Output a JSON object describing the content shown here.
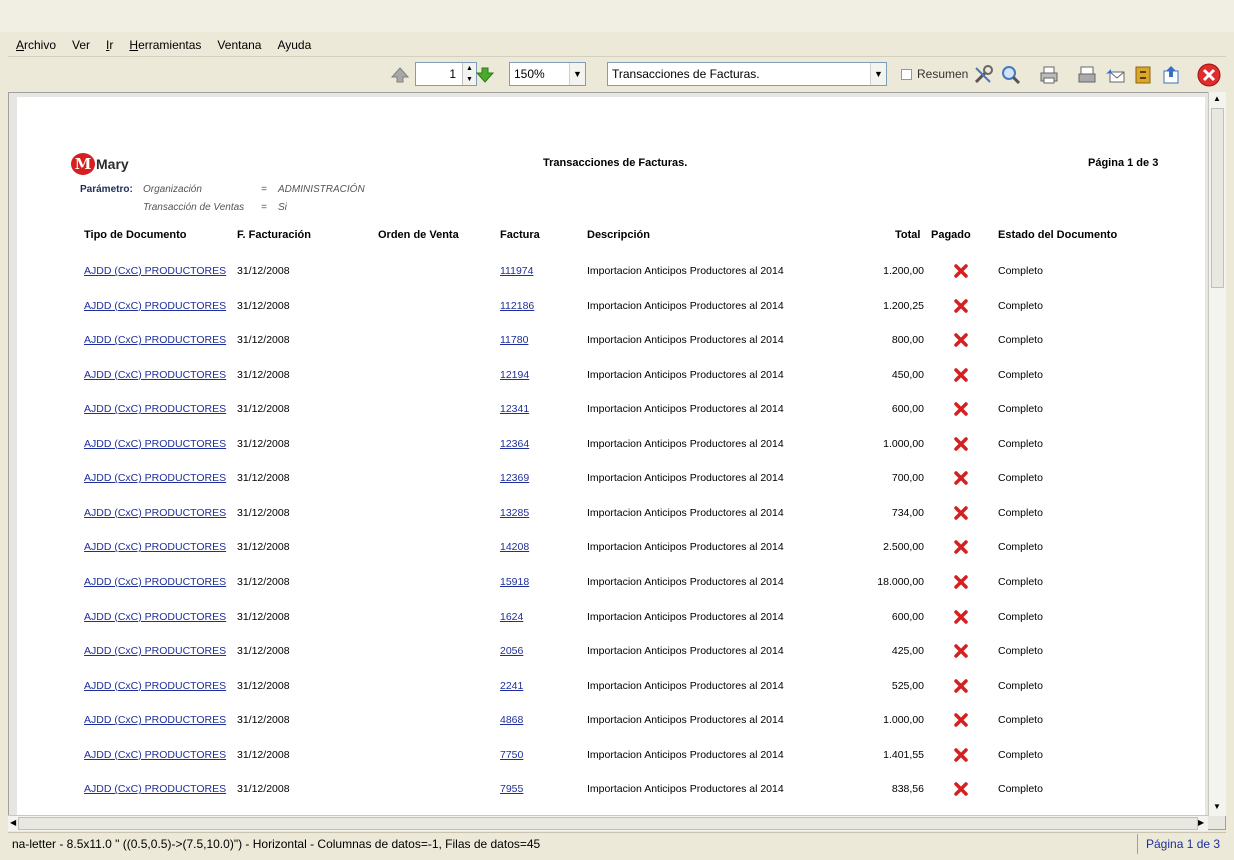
{
  "menu": [
    {
      "label": "Archivo",
      "mnemonic": "A"
    },
    {
      "label": "Ver",
      "mnemonic": ""
    },
    {
      "label": "Ir",
      "mnemonic": "I"
    },
    {
      "label": "Herramientas",
      "mnemonic": "H"
    },
    {
      "label": "Ventana",
      "mnemonic": ""
    },
    {
      "label": "Ayuda",
      "mnemonic": ""
    }
  ],
  "toolbar": {
    "page_value": "1",
    "zoom_value": "150%",
    "report_value": "Transacciones de Facturas.",
    "resumen_label": "Resumen",
    "icons": {
      "prev": "arrow-up-icon",
      "next": "arrow-down-icon",
      "customize": "tools-icon",
      "find": "magnifier-icon",
      "print": "printer-icon",
      "fax": "print-setup-icon",
      "email": "send-mail-icon",
      "archive": "archive-icon",
      "export": "export-icon",
      "close": "close-icon"
    }
  },
  "report": {
    "title": "Transacciones de Facturas.",
    "page_label": "Página 1 de 3",
    "logo_text": "Mary",
    "logo_sub": "",
    "param_label": "Parámetro:",
    "params": [
      {
        "name": "Organización",
        "eq": "=",
        "value": "ADMINISTRACIÓN"
      },
      {
        "name": "Transacción de Ventas",
        "eq": "=",
        "value": "Si"
      }
    ],
    "columns": {
      "tipo": "Tipo de Documento",
      "fecha": "F. Facturación",
      "orden": "Orden de Venta",
      "factura": "Factura",
      "descripcion": "Descripción",
      "total": "Total",
      "pagado": "Pagado",
      "estado": "Estado del Documento"
    },
    "rows": [
      {
        "tipo": "AJDD (CxC) PRODUCTORES",
        "fecha": "31/12/2008",
        "orden": "",
        "factura": "111974",
        "descripcion": "Importacion Anticipos Productores al 2014",
        "total": "1.200,00",
        "estado": "Completo"
      },
      {
        "tipo": "AJDD (CxC) PRODUCTORES",
        "fecha": "31/12/2008",
        "orden": "",
        "factura": "112186",
        "descripcion": "Importacion Anticipos Productores al 2014",
        "total": "1.200,25",
        "estado": "Completo"
      },
      {
        "tipo": "AJDD (CxC) PRODUCTORES",
        "fecha": "31/12/2008",
        "orden": "",
        "factura": "11780",
        "descripcion": "Importacion Anticipos Productores al 2014",
        "total": "800,00",
        "estado": "Completo"
      },
      {
        "tipo": "AJDD (CxC) PRODUCTORES",
        "fecha": "31/12/2008",
        "orden": "",
        "factura": "12194",
        "descripcion": "Importacion Anticipos Productores al 2014",
        "total": "450,00",
        "estado": "Completo"
      },
      {
        "tipo": "AJDD (CxC) PRODUCTORES",
        "fecha": "31/12/2008",
        "orden": "",
        "factura": "12341",
        "descripcion": "Importacion Anticipos Productores al 2014",
        "total": "600,00",
        "estado": "Completo"
      },
      {
        "tipo": "AJDD (CxC) PRODUCTORES",
        "fecha": "31/12/2008",
        "orden": "",
        "factura": "12364",
        "descripcion": "Importacion Anticipos Productores al 2014",
        "total": "1.000,00",
        "estado": "Completo"
      },
      {
        "tipo": "AJDD (CxC) PRODUCTORES",
        "fecha": "31/12/2008",
        "orden": "",
        "factura": "12369",
        "descripcion": "Importacion Anticipos Productores al 2014",
        "total": "700,00",
        "estado": "Completo"
      },
      {
        "tipo": "AJDD (CxC) PRODUCTORES",
        "fecha": "31/12/2008",
        "orden": "",
        "factura": "13285",
        "descripcion": "Importacion Anticipos Productores al 2014",
        "total": "734,00",
        "estado": "Completo"
      },
      {
        "tipo": "AJDD (CxC) PRODUCTORES",
        "fecha": "31/12/2008",
        "orden": "",
        "factura": "14208",
        "descripcion": "Importacion Anticipos Productores al 2014",
        "total": "2.500,00",
        "estado": "Completo"
      },
      {
        "tipo": "AJDD (CxC) PRODUCTORES",
        "fecha": "31/12/2008",
        "orden": "",
        "factura": "15918",
        "descripcion": "Importacion Anticipos Productores al 2014",
        "total": "18.000,00",
        "estado": "Completo"
      },
      {
        "tipo": "AJDD (CxC) PRODUCTORES",
        "fecha": "31/12/2008",
        "orden": "",
        "factura": "1624",
        "descripcion": "Importacion Anticipos Productores al 2014",
        "total": "600,00",
        "estado": "Completo"
      },
      {
        "tipo": "AJDD (CxC) PRODUCTORES",
        "fecha": "31/12/2008",
        "orden": "",
        "factura": "2056",
        "descripcion": "Importacion Anticipos Productores al 2014",
        "total": "425,00",
        "estado": "Completo"
      },
      {
        "tipo": "AJDD (CxC) PRODUCTORES",
        "fecha": "31/12/2008",
        "orden": "",
        "factura": "2241",
        "descripcion": "Importacion Anticipos Productores al 2014",
        "total": "525,00",
        "estado": "Completo"
      },
      {
        "tipo": "AJDD (CxC) PRODUCTORES",
        "fecha": "31/12/2008",
        "orden": "",
        "factura": "4868",
        "descripcion": "Importacion Anticipos Productores al 2014",
        "total": "1.000,00",
        "estado": "Completo"
      },
      {
        "tipo": "AJDD (CxC) PRODUCTORES",
        "fecha": "31/12/2008",
        "orden": "",
        "factura": "7750",
        "descripcion": "Importacion Anticipos Productores al 2014",
        "total": "1.401,55",
        "estado": "Completo"
      },
      {
        "tipo": "AJDD (CxC) PRODUCTORES",
        "fecha": "31/12/2008",
        "orden": "",
        "factura": "7955",
        "descripcion": "Importacion Anticipos Productores al 2014",
        "total": "838,56",
        "estado": "Completo"
      }
    ]
  },
  "status": {
    "left": "na-letter - 8.5x11.0 \" ((0.5,0.5)->(7.5,10.0)\") - Horizontal - Columnas de datos=-1, Filas de datos=45",
    "right": "Página 1 de 3"
  },
  "colors": {
    "link": "#1e2e9a",
    "paid_x": "#d42020",
    "background": "#ece9d8"
  }
}
